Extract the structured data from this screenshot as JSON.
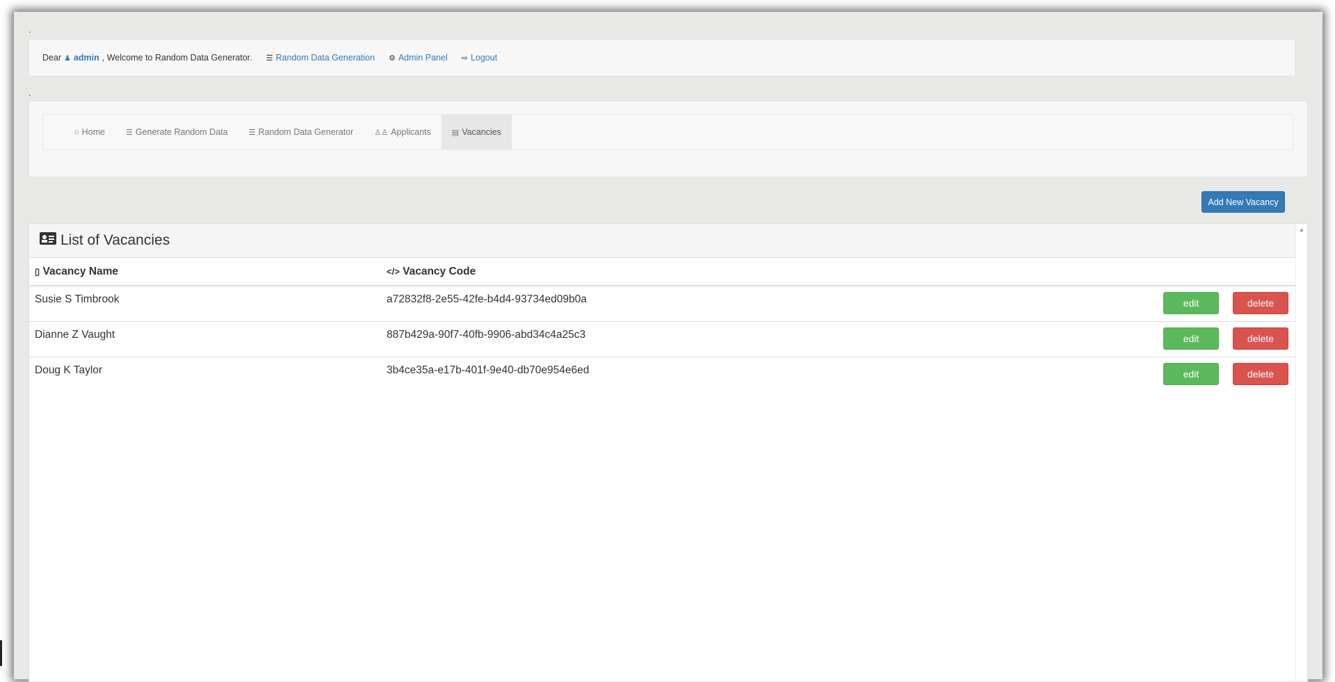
{
  "top_dot_1": ".",
  "top_dot_2": ".",
  "topbar": {
    "dear": "Dear",
    "user": "admin",
    "welcome": ", Welcome to Random Data Generator.",
    "links": [
      {
        "icon": "database-icon",
        "label": "Random Data Generation"
      },
      {
        "icon": "gears-icon",
        "label": "Admin Panel"
      },
      {
        "icon": "sign-out-icon",
        "label": "Logout"
      }
    ]
  },
  "nav": {
    "items": [
      {
        "icon": "home-icon",
        "label": "Home"
      },
      {
        "icon": "database-icon",
        "label": "Generate Random Data"
      },
      {
        "icon": "database-icon",
        "label": "Random Data Generator"
      },
      {
        "icon": "users-icon",
        "label": "Applicants"
      },
      {
        "icon": "id-card-icon",
        "label": "Vacancies"
      }
    ],
    "active": "Vacancies"
  },
  "add_button": "Add New Vacancy",
  "panel": {
    "title": "List of Vacancies",
    "columns": [
      "Vacancy Name",
      "Vacancy Code"
    ],
    "rows": [
      {
        "name": "Susie S Timbrook",
        "code": "a72832f8-2e55-42fe-b4d4-93734ed09b0a"
      },
      {
        "name": "Dianne Z Vaught",
        "code": "887b429a-90f7-40fb-9906-abd34c4a25c3"
      },
      {
        "name": "Doug K Taylor",
        "code": "3b4ce35a-e17b-401f-9e40-db70e954e6ed"
      }
    ],
    "edit_label": "edit",
    "delete_label": "delete"
  },
  "colors": {
    "primary": "#337ab7",
    "success": "#5cb85c",
    "danger": "#d9534f"
  }
}
